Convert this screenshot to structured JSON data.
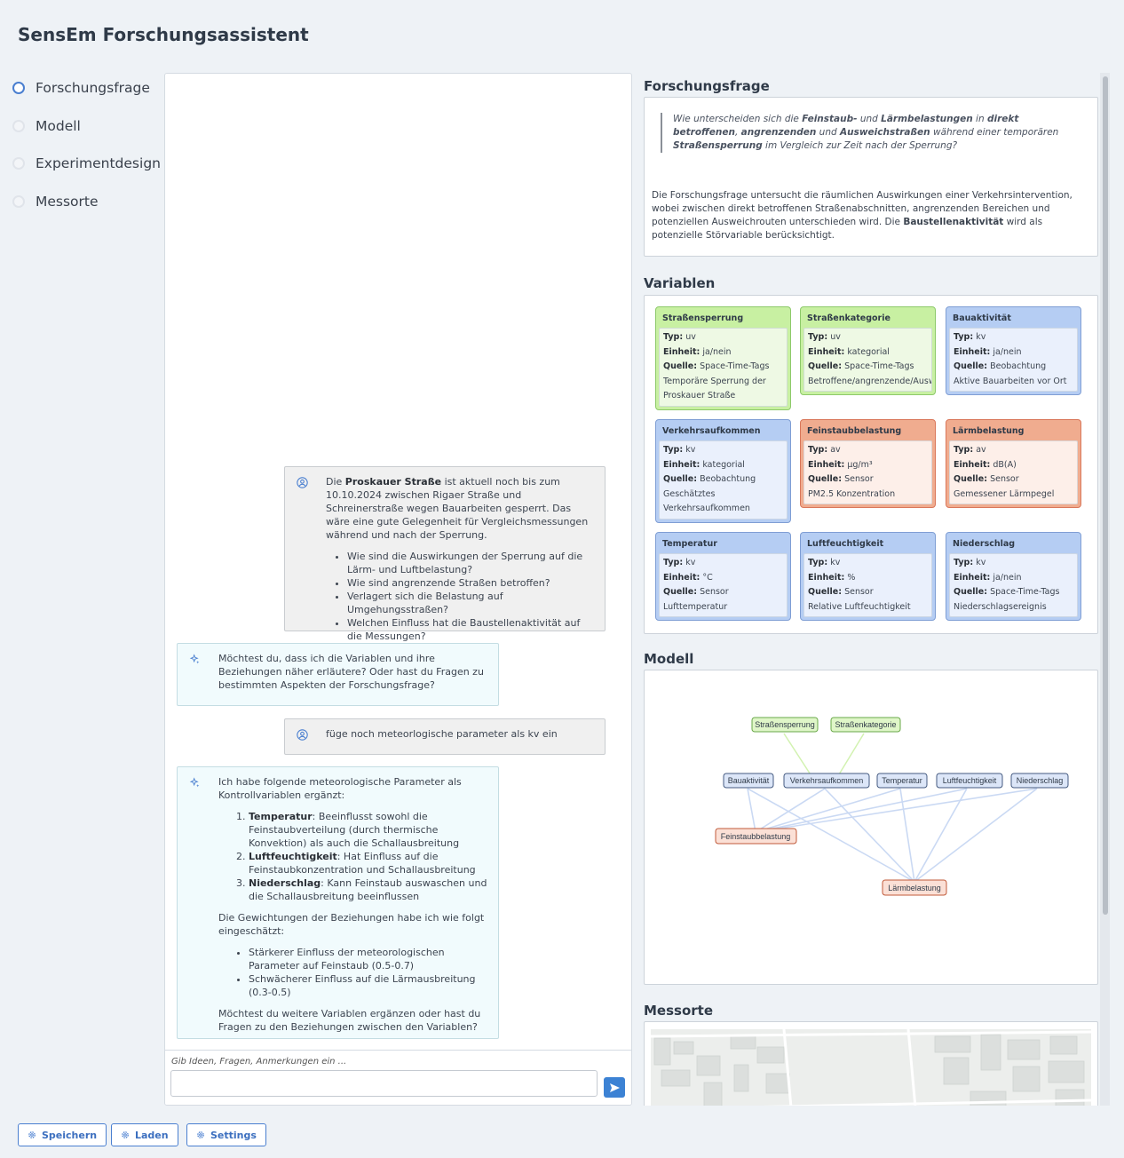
{
  "app": {
    "title": "SensEm Forschungsassistent"
  },
  "steps": [
    {
      "label": "Forschungsfrage",
      "active": true
    },
    {
      "label": "Modell",
      "active": false
    },
    {
      "label": "Experimentdesign",
      "active": false
    },
    {
      "label": "Messorte",
      "active": false
    }
  ],
  "chat": {
    "msg1": {
      "part1_prefix": "Die ",
      "part1_bold": "Proskauer Straße",
      "part1_rest": " ist aktuell noch bis zum 10.10.2024 zwischen Rigaer Straße und Schreinerstraße wegen Bauarbeiten gesperrt. Das wäre eine gute Gelegenheit für Vergleichsmessungen während und nach der Sperrung.",
      "bullets": [
        "Wie sind die Auswirkungen der Sperrung auf die Lärm- und Luftbelastung?",
        "Wie sind angrenzende Straßen betroffen?",
        "Verlagert sich die Belastung auf Umgehungsstraßen?",
        "Welchen Einfluss hat die Baustellenaktivität auf die Messungen?"
      ]
    },
    "msg2": {
      "text": "Möchtest du, dass ich die Variablen und ihre Beziehungen näher erläutere? Oder hast du Fragen zu bestimmten Aspekten der Forschungsfrage?"
    },
    "msg3": {
      "text": "füge noch meteorlogische parameter als kv ein"
    },
    "msg4": {
      "intro": "Ich habe folgende meteorologische Parameter als Kontrollvariablen ergänzt:",
      "items": [
        {
          "bold": "Temperatur",
          "rest": ": Beeinflusst sowohl die Feinstaubverteilung (durch thermische Konvektion) als auch die Schallausbreitung"
        },
        {
          "bold": "Luftfeuchtigkeit",
          "rest": ": Hat Einfluss auf die Feinstaubkonzentration und Schallausbreitung"
        },
        {
          "bold": "Niederschlag",
          "rest": ": Kann Feinstaub auswaschen und die Schallausbreitung beeinflussen"
        }
      ],
      "weights_intro": "Die Gewichtungen der Beziehungen habe ich wie folgt eingeschätzt:",
      "weights": [
        "Stärkerer Einfluss der meteorologischen Parameter auf Feinstaub (0.5-0.7)",
        "Schwächerer Einfluss auf die Lärmausbreitung (0.3-0.5)"
      ],
      "outro": "Möchtest du weitere Variablen ergänzen oder hast du Fragen zu den Beziehungen zwischen den Variablen?"
    },
    "input_label": "Gib Ideen, Fragen, Anmerkungen ein ...",
    "input_value": "",
    "input_placeholder": ""
  },
  "right": {
    "rq_heading": "Forschungsfrage",
    "rq_quote": {
      "t1": "Wie unterscheiden sich die ",
      "b1": "Feinstaub-",
      "t2": " und ",
      "b2": "Lärmbelastungen",
      "t3": " in ",
      "b3": "direkt betroffenen",
      "t4": ", ",
      "b4": "angrenzenden",
      "t5": " und ",
      "b5": "Ausweichstraßen",
      "t6": " während einer temporären ",
      "b6": "Straßensperrung",
      "t7": " im Vergleich zur Zeit nach der Sperrung?"
    },
    "rq_desc": {
      "text": "Die Forschungsfrage untersucht die räumlichen Auswirkungen einer Verkehrsintervention, wobei zwischen direkt betroffenen Straßenabschnitten, angrenzenden Bereichen und potenziellen Ausweichrouten unterschieden wird. Die ",
      "bold": "Baustellenaktivität",
      "rest": " wird als potenzielle Störvariable berücksichtigt."
    },
    "vars_heading": "Variablen",
    "field_labels": {
      "typ": "Typ:",
      "einheit": "Einheit:",
      "quelle": "Quelle:"
    },
    "variables": [
      {
        "name": "Straßensperrung",
        "typ": "uv",
        "einheit": "ja/nein",
        "quelle": "Space-Time-Tags",
        "desc1": "Temporäre Sperrung der",
        "desc2": "Proskauer Straße",
        "color": "#c8f0a2"
      },
      {
        "name": "Straßenkategorie",
        "typ": "uv",
        "einheit": "kategorial",
        "quelle": "Space-Time-Tags",
        "desc1": "Betroffene/angrenzende/Ausweic",
        "desc2": "",
        "color": "#c8f0a2"
      },
      {
        "name": "Bauaktivität",
        "typ": "kv",
        "einheit": "ja/nein",
        "quelle": "Beobachtung",
        "desc1": "Aktive Bauarbeiten vor Ort",
        "desc2": "",
        "color": "#b5cdf3"
      },
      {
        "name": "Verkehrsaufkommen",
        "typ": "kv",
        "einheit": "kategorial",
        "quelle": "Beobachtung",
        "desc1": "Geschätztes",
        "desc2": "Verkehrsaufkommen",
        "color": "#b5cdf3"
      },
      {
        "name": "Feinstaubbelastung",
        "typ": "av",
        "einheit": "µg/m³",
        "quelle": "Sensor",
        "desc1": "PM2.5 Konzentration",
        "desc2": "",
        "color": "#f0ac8f"
      },
      {
        "name": "Lärmbelastung",
        "typ": "av",
        "einheit": "dB(A)",
        "quelle": "Sensor",
        "desc1": "Gemessener Lärmpegel",
        "desc2": "",
        "color": "#f0ac8f"
      },
      {
        "name": "Temperatur",
        "typ": "kv",
        "einheit": "°C",
        "quelle": "Sensor",
        "desc1": "Lufttemperatur",
        "desc2": "",
        "color": "#b5cdf3"
      },
      {
        "name": "Luftfeuchtigkeit",
        "typ": "kv",
        "einheit": "%",
        "quelle": "Sensor",
        "desc1": "Relative Luftfeuchtigkeit",
        "desc2": "",
        "color": "#b5cdf3"
      },
      {
        "name": "Niederschlag",
        "typ": "kv",
        "einheit": "ja/nein",
        "quelle": "Space-Time-Tags",
        "desc1": "Niederschlagsereignis",
        "desc2": "",
        "color": "#b5cdf3"
      }
    ],
    "model_heading": "Modell",
    "model_nodes": {
      "sperrung": "Straßensperrung",
      "kategorie": "Straßenkategorie",
      "bau": "Bauaktivität",
      "verkehr": "Verkehrsaufkommen",
      "temp": "Temperatur",
      "feucht": "Luftfeuchtigkeit",
      "nieder": "Niederschlag",
      "fein": "Feinstaubbelastung",
      "laerm": "Lärmbelastung"
    },
    "messorte_heading": "Messorte"
  },
  "buttons": {
    "save": "Speichern",
    "load": "Laden",
    "settings": "Settings"
  },
  "colors": {
    "accent": "#3c82d4",
    "uv": "#c8f0a2",
    "kv": "#b5cdf3",
    "av": "#f0ac8f"
  }
}
